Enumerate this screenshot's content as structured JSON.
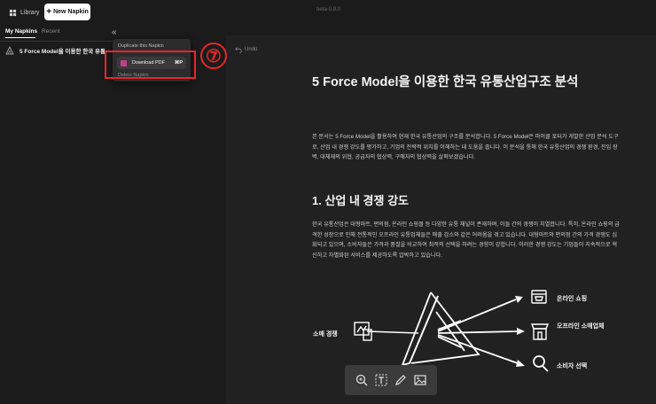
{
  "topbar": {
    "library_label": "Library",
    "new_napkin_label": "New Napkin",
    "version": "beta-0.9.0"
  },
  "sidebar": {
    "tabs": [
      {
        "label": "My Napkins",
        "active": true
      },
      {
        "label": "Recent",
        "active": false
      }
    ],
    "collapse_glyph": "«",
    "items": [
      {
        "title": "5 Force Model을 이용한 한국 유통",
        "icon": "napkin-icon"
      }
    ]
  },
  "context_menu": {
    "items": [
      {
        "label": "Duplicate this Napkin"
      },
      {
        "label": "Download PDF",
        "shortcut": "⌘P"
      },
      {
        "label": "Delete Napkin"
      }
    ]
  },
  "annotation": {
    "step": "⑦",
    "color": "#e5262b"
  },
  "editor": {
    "undo_label": "Undo",
    "title": "5 Force Model을 이용한 한국 유통산업구조 분석",
    "intro": "본 문서는 5 Force Model을 활용하여 현재 한국 유통산업의 구조를 분석합니다. 5 Force Model은 마이클 포터가 개발한 산업 분석 도구로, 산업 내 경쟁 강도를 평가하고, 기업의 전략적 위치를 이해하는 데 도움을 줍니다. 이 분석을 통해 한국 유통산업의 경쟁 환경, 진입 장벽, 대체재의 위협, 공급자의 협상력, 구매자의 협상력을 살펴보겠습니다.",
    "section1_heading": "1. 산업 내 경쟁 강도",
    "section1_body": "한국 유통산업은 대형마트, 편의점, 온라인 쇼핑몰 등 다양한 유통 채널이 존재하며, 이들 간의 경쟁이 치열합니다. 특히, 온라인 쇼핑의 급격한 성장으로 인해 전통적인 오프라인 유통업체들은 매출 감소와 같은 어려움을 겪고 있습니다. 대형마트와 편의점 간의 가격 경쟁도 심화되고 있으며, 소비자들은 가격과 품질을 비교하여 최적의 선택을 하려는 경향이 강합니다. 이러한 경쟁 강도는 기업들이 지속적으로 혁신하고 차별화된 서비스를 제공하도록 압박하고 있습니다.",
    "illustration": {
      "left_label": "소매 경쟁",
      "right_labels": [
        "온라인 쇼핑",
        "오프라인 소매업체",
        "소비자 선택"
      ]
    }
  },
  "toolbar": {
    "tools": [
      "magic-zoom-icon",
      "text-box-icon",
      "pen-icon",
      "image-icon"
    ]
  }
}
